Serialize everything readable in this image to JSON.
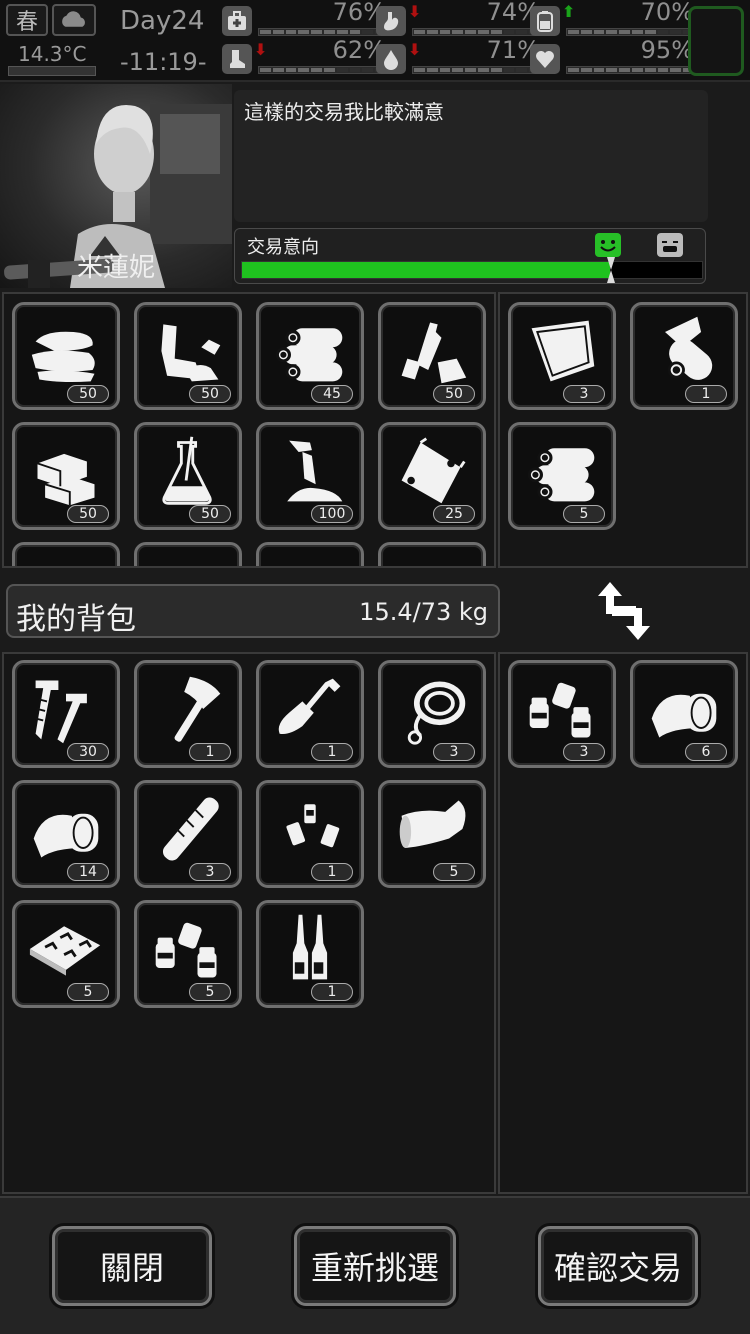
{
  "status": {
    "season": "春",
    "weather_icon": "cloud-icon",
    "temperature": "14.3°C",
    "day": "Day24",
    "time": "-11:19-",
    "stats": [
      {
        "name": "health",
        "icon": "medkit-icon",
        "percent": "76%",
        "trend": "",
        "fill": 0.76
      },
      {
        "name": "hunger",
        "icon": "stomach-icon",
        "percent": "74%",
        "trend": "down",
        "fill": 0.74
      },
      {
        "name": "energy",
        "icon": "battery-icon",
        "percent": "70%",
        "trend": "up",
        "fill": 0.7
      },
      {
        "name": "stamina",
        "icon": "boot-icon",
        "percent": "62%",
        "trend": "down",
        "fill": 0.62
      },
      {
        "name": "thirst",
        "icon": "water-drop-icon",
        "percent": "71%",
        "trend": "down",
        "fill": 0.71
      },
      {
        "name": "mood",
        "icon": "heart-icon",
        "percent": "95%",
        "trend": "",
        "fill": 0.95
      }
    ],
    "trend_colors": {
      "up": "#1aa31a",
      "down": "#b01010"
    }
  },
  "trader": {
    "name": "米蓮妮",
    "message": "這樣的交易我比較滿意"
  },
  "intent": {
    "label": "交易意向",
    "value": 0.8,
    "bar_color": "#1fc21f"
  },
  "trader_items": [
    {
      "icon": "cloth-icon",
      "count": "50"
    },
    {
      "icon": "scrap-leather-icon",
      "count": "50"
    },
    {
      "icon": "logs-icon",
      "count": "45"
    },
    {
      "icon": "plastic-bottles-icon",
      "count": "50"
    },
    {
      "icon": "wooden-blocks-icon",
      "count": "50"
    },
    {
      "icon": "flask-icon",
      "count": "50"
    },
    {
      "icon": "glue-icon",
      "count": "100"
    },
    {
      "icon": "plastic-bag-icon",
      "count": "25"
    }
  ],
  "trader_offer": [
    {
      "icon": "tarp-icon",
      "count": "3"
    },
    {
      "icon": "paper-roll-icon",
      "count": "1"
    },
    {
      "icon": "logs-icon",
      "count": "5"
    }
  ],
  "backpack": {
    "title": "我的背包",
    "weight": "15.4/73 kg"
  },
  "my_items": [
    {
      "icon": "nails-icon",
      "count": "30"
    },
    {
      "icon": "axe-icon",
      "count": "1"
    },
    {
      "icon": "shovel-icon",
      "count": "1"
    },
    {
      "icon": "rope-icon",
      "count": "3"
    },
    {
      "icon": "bandage-roll-icon",
      "count": "14"
    },
    {
      "icon": "splint-icon",
      "count": "3"
    },
    {
      "icon": "pill-bottles-icon",
      "count": "1"
    },
    {
      "icon": "cast-icon",
      "count": "5"
    },
    {
      "icon": "pill-tray-icon",
      "count": "5"
    },
    {
      "icon": "medicine-jars-icon",
      "count": "5"
    },
    {
      "icon": "ampoules-icon",
      "count": "1"
    }
  ],
  "my_offer": [
    {
      "icon": "medicine-jars-icon",
      "count": "3"
    },
    {
      "icon": "bandage-roll-icon",
      "count": "6"
    }
  ],
  "buttons": {
    "close": "關閉",
    "reselect": "重新挑選",
    "confirm": "確認交易"
  }
}
